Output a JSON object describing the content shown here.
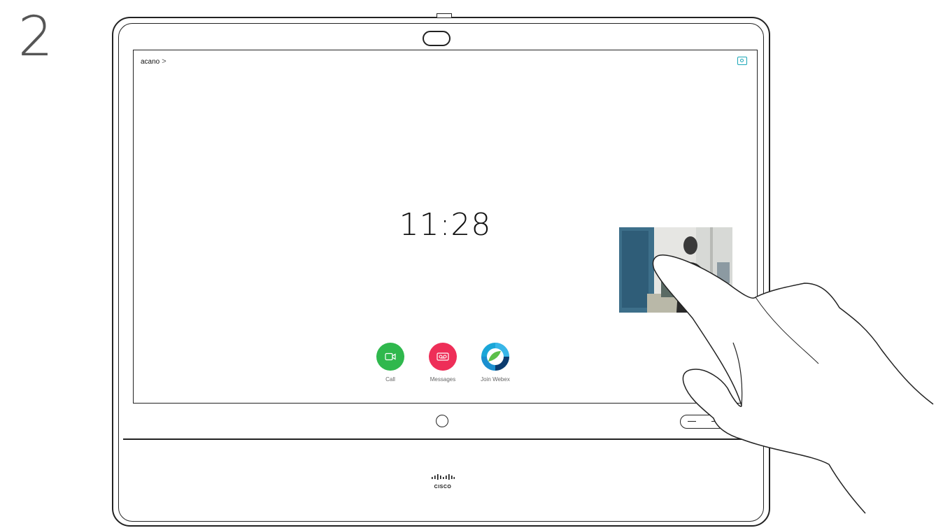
{
  "step_number": "2",
  "header": {
    "breadcrumb_label": "acano",
    "breadcrumb_chevron": ">"
  },
  "clock": {
    "time": "11:28"
  },
  "actions": [
    {
      "label": "Call",
      "color": "#2fb84d",
      "icon": "video-camera-icon"
    },
    {
      "label": "Messages",
      "color": "#ee2e58",
      "icon": "voicemail-icon"
    },
    {
      "label": "Join Webex",
      "color": "#1aa6d8",
      "icon": "webex-icon"
    }
  ],
  "selfview_icon": "selfview-icon",
  "brand": {
    "name": "CISCO"
  },
  "colors": {
    "accent": "#1aa6b7"
  }
}
